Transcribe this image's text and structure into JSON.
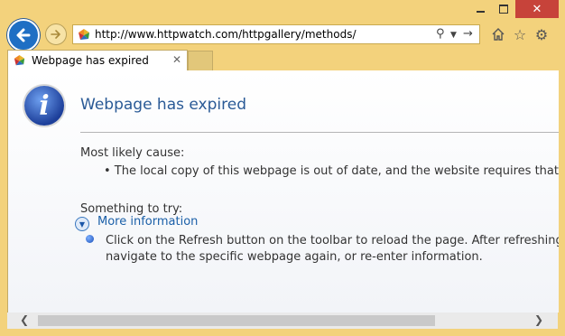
{
  "window": {
    "minimize_label": "Minimize",
    "maximize_label": "Maximize",
    "close_label": "Close"
  },
  "nav": {
    "url": "http://www.httpwatch.com/httpgallery/methods/"
  },
  "tab": {
    "title": "Webpage has expired",
    "close_glyph": "✕"
  },
  "page": {
    "headline": "Webpage has expired",
    "cause_heading": "Most likely cause:",
    "cause_item": "•  The local copy of this webpage is out of date, and the website requires that yo",
    "try_heading": "Something to try:",
    "try_line1": "Click on the Refresh button on the toolbar to reload the page. After refreshing,",
    "try_line2": "navigate to the specific webpage again, or re-enter information.",
    "more_info": "More information"
  }
}
